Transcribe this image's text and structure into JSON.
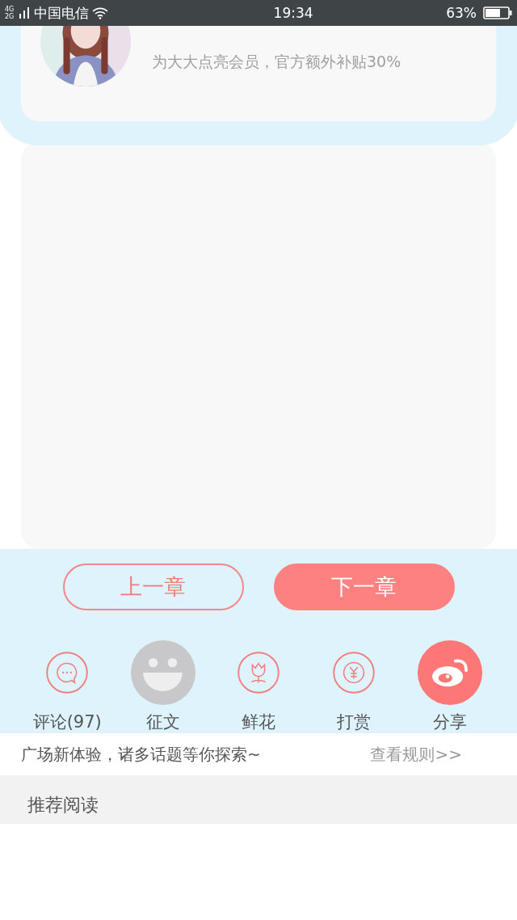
{
  "status_bar": {
    "network": "4G 2G",
    "carrier": "中国电信",
    "time": "19:34",
    "battery": "63%"
  },
  "profile": {
    "kind": "picture",
    "subtitle": "为大大点亮会员，官方额外补贴30%"
  },
  "chapter_nav": [
    {
      "label": "上一章",
      "kind": "outline"
    },
    {
      "label": "下一章",
      "kind": "filled"
    }
  ],
  "actions": [
    {
      "label": "评论(97)",
      "kind": "comment"
    },
    {
      "label": "征文",
      "kind": "smiley"
    },
    {
      "label": "鲜花",
      "kind": "flower"
    },
    {
      "label": "打赏",
      "kind": "yen"
    },
    {
      "label": "分享",
      "kind": "share"
    }
  ],
  "notice": {
    "text": "广场新体验，诸多话题等你探索~",
    "link": "查看规则>>"
  },
  "recommend": {
    "title": "推荐阅读"
  }
}
